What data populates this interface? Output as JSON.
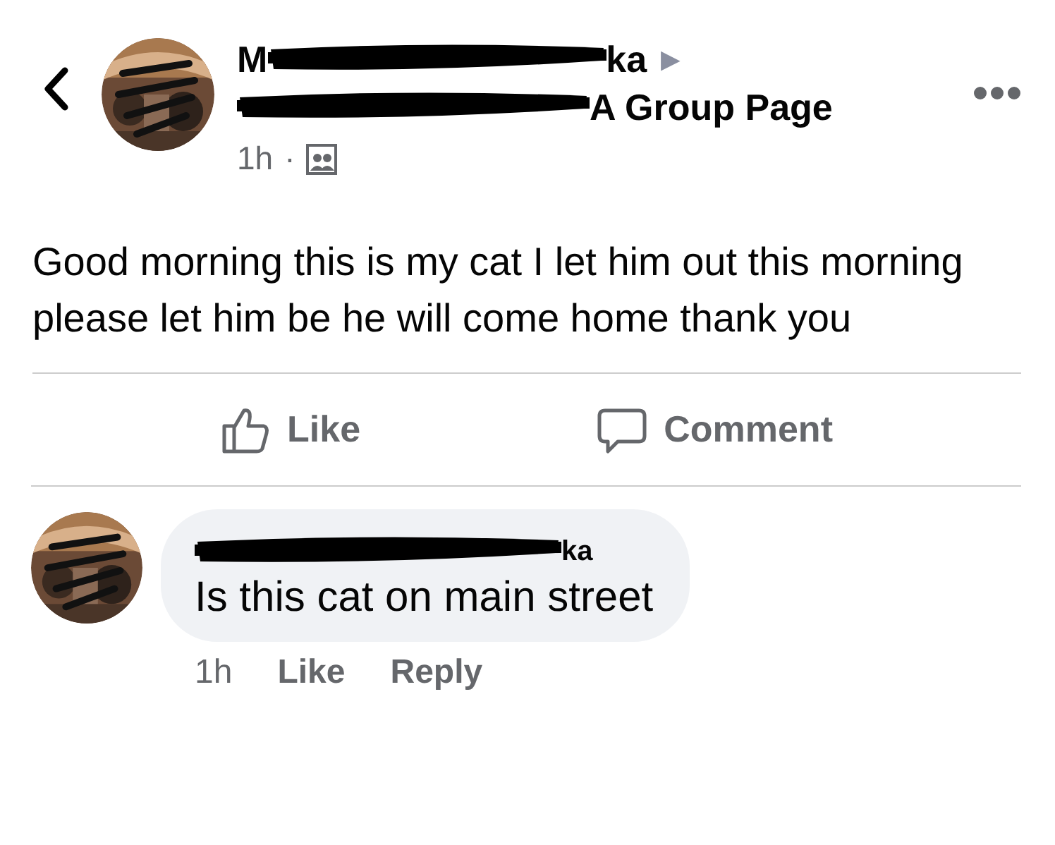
{
  "post": {
    "author": {
      "start": "M",
      "end": "ka",
      "arrow": "▶"
    },
    "group": {
      "end": "A Group Page"
    },
    "time": "1h",
    "separator": "·",
    "text": "Good morning this is my cat I let him out this morning please let him be he will come home thank you"
  },
  "actions": [
    {
      "kind": "like",
      "label": "Like"
    },
    {
      "kind": "comment",
      "label": "Comment"
    }
  ],
  "comment": {
    "author": {
      "end": "ka"
    },
    "text": "Is this cat on main street",
    "time": "1h",
    "actions": [
      "Like",
      "Reply"
    ]
  }
}
